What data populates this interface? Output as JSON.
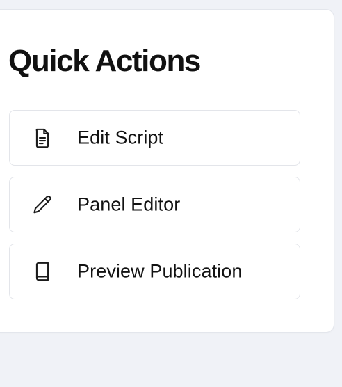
{
  "panel": {
    "title": "Quick Actions"
  },
  "actions": [
    {
      "label": "Edit Script",
      "icon": "document-icon"
    },
    {
      "label": "Panel Editor",
      "icon": "pencil-icon"
    },
    {
      "label": "Preview Publication",
      "icon": "book-icon"
    }
  ],
  "colors": {
    "page_background": "#f0f2f7",
    "card_background": "#ffffff",
    "border": "#e3e5ea",
    "text": "#121212"
  }
}
